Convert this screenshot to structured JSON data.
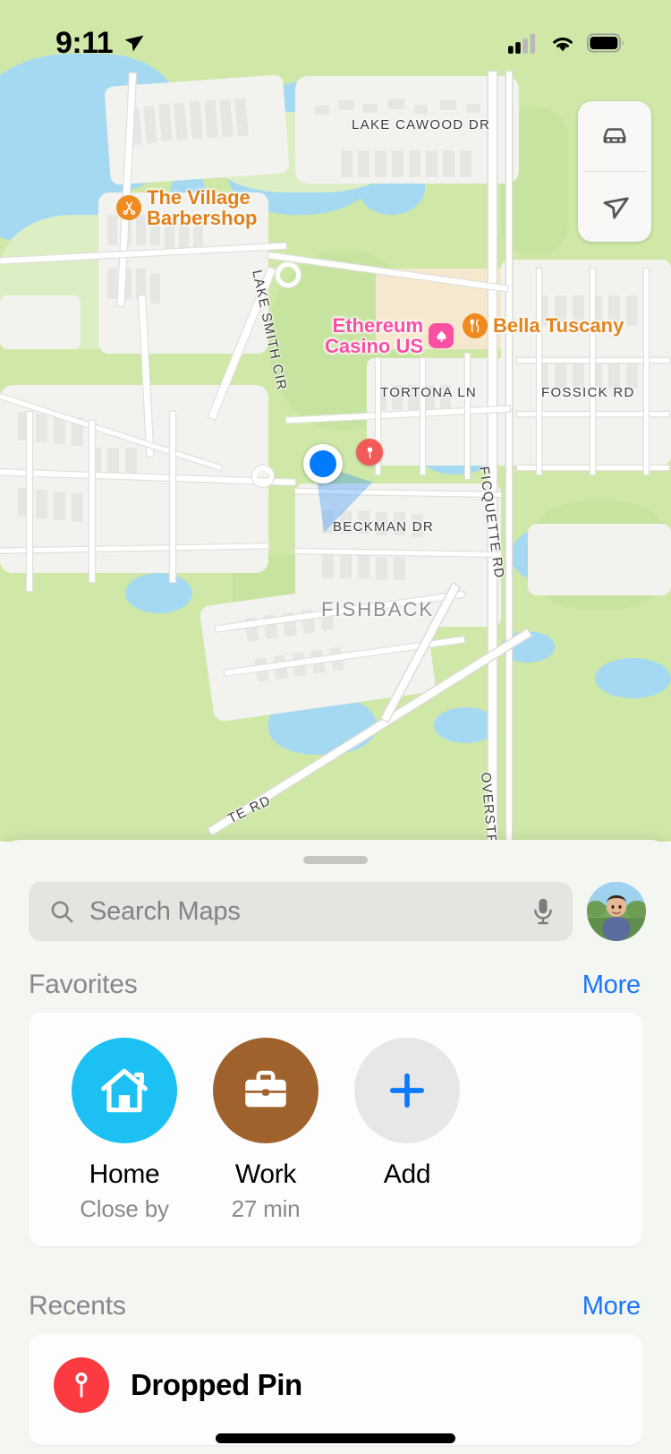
{
  "status_bar": {
    "time": "9:11",
    "location_arrow_icon": "location-arrow-icon",
    "cellular_icon": "cellular-signal-icon",
    "wifi_icon": "wifi-icon",
    "battery_icon": "battery-icon"
  },
  "map": {
    "controls": {
      "drive_icon": "car-icon",
      "locate_icon": "navigation-arrow-icon"
    },
    "user_location_icon": "blue-location-dot",
    "dropped_pin_icon": "red-map-pin",
    "pois": [
      {
        "name": "The Village\nBarbershop",
        "icon": "scissors-icon",
        "color": "#ef8c20"
      },
      {
        "name": "Ethereum\nCasino US",
        "icon": "casino-spade-icon",
        "color": "#fb4fa3"
      },
      {
        "name": "Bella Tuscany",
        "icon": "restaurant-fork-knife-icon",
        "color": "#f08a20"
      }
    ],
    "street_labels": [
      "LAKE CAWOOD DR",
      "LAKE SMITH CIR",
      "TORTONA LN",
      "FOSSICK RD",
      "BECKMAN DR",
      "FICQUETTE RD",
      "OVERSTR",
      "TE RD"
    ],
    "neighborhood_label": "FISHBACK"
  },
  "sheet": {
    "search": {
      "placeholder": "Search Maps",
      "search_icon": "search-icon",
      "mic_icon": "microphone-icon",
      "avatar_icon": "user-avatar"
    },
    "favorites": {
      "title": "Favorites",
      "more_label": "More",
      "items": [
        {
          "label": "Home",
          "sub": "Close by",
          "icon": "house-icon",
          "color": "#1cc0f3"
        },
        {
          "label": "Work",
          "sub": "27 min",
          "icon": "briefcase-icon",
          "color": "#a0622d"
        },
        {
          "label": "Add",
          "sub": "",
          "icon": "plus-icon",
          "color": "#e7e7e7"
        }
      ]
    },
    "recents": {
      "title": "Recents",
      "more_label": "More",
      "items": [
        {
          "label": "Dropped Pin",
          "icon": "map-pin-icon"
        }
      ]
    }
  },
  "colors": {
    "accent_blue": "#1a75ff",
    "map_green": "#cfe8a8",
    "map_water": "#a5d9f2",
    "sheet_bg": "#f4f6f1"
  }
}
